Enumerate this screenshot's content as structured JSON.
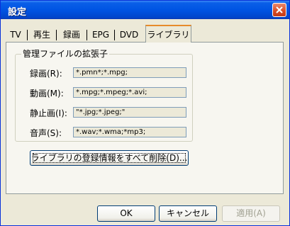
{
  "window": {
    "title": "設定"
  },
  "tabs": [
    {
      "label": "TV"
    },
    {
      "label": "再生"
    },
    {
      "label": "録画"
    },
    {
      "label": "EPG"
    },
    {
      "label": "DVD"
    },
    {
      "label": "ライブラリ",
      "active": true
    }
  ],
  "group": {
    "label": "管理ファイルの拡張子",
    "rows": [
      {
        "label": "録画(R):",
        "value": "*.pmn*;*.mpg;"
      },
      {
        "label": "動画(M):",
        "value": "*.mpg;*.mpeg;*.avi;"
      },
      {
        "label": "静止画(I):",
        "value": "\"*.jpg;*.jpeg;\""
      },
      {
        "label": "音声(S):",
        "value": "*.wav;*.wma;*mp3;"
      }
    ]
  },
  "delete_button": "ライブラリの登録情報をすべて削除(D)...",
  "footer": {
    "ok": "OK",
    "cancel": "キャンセル",
    "apply": "適用(A)"
  },
  "colors": {
    "titlebar": "#0054e3",
    "close": "#d84a23",
    "active_tab_accent": "#e68b2c"
  }
}
